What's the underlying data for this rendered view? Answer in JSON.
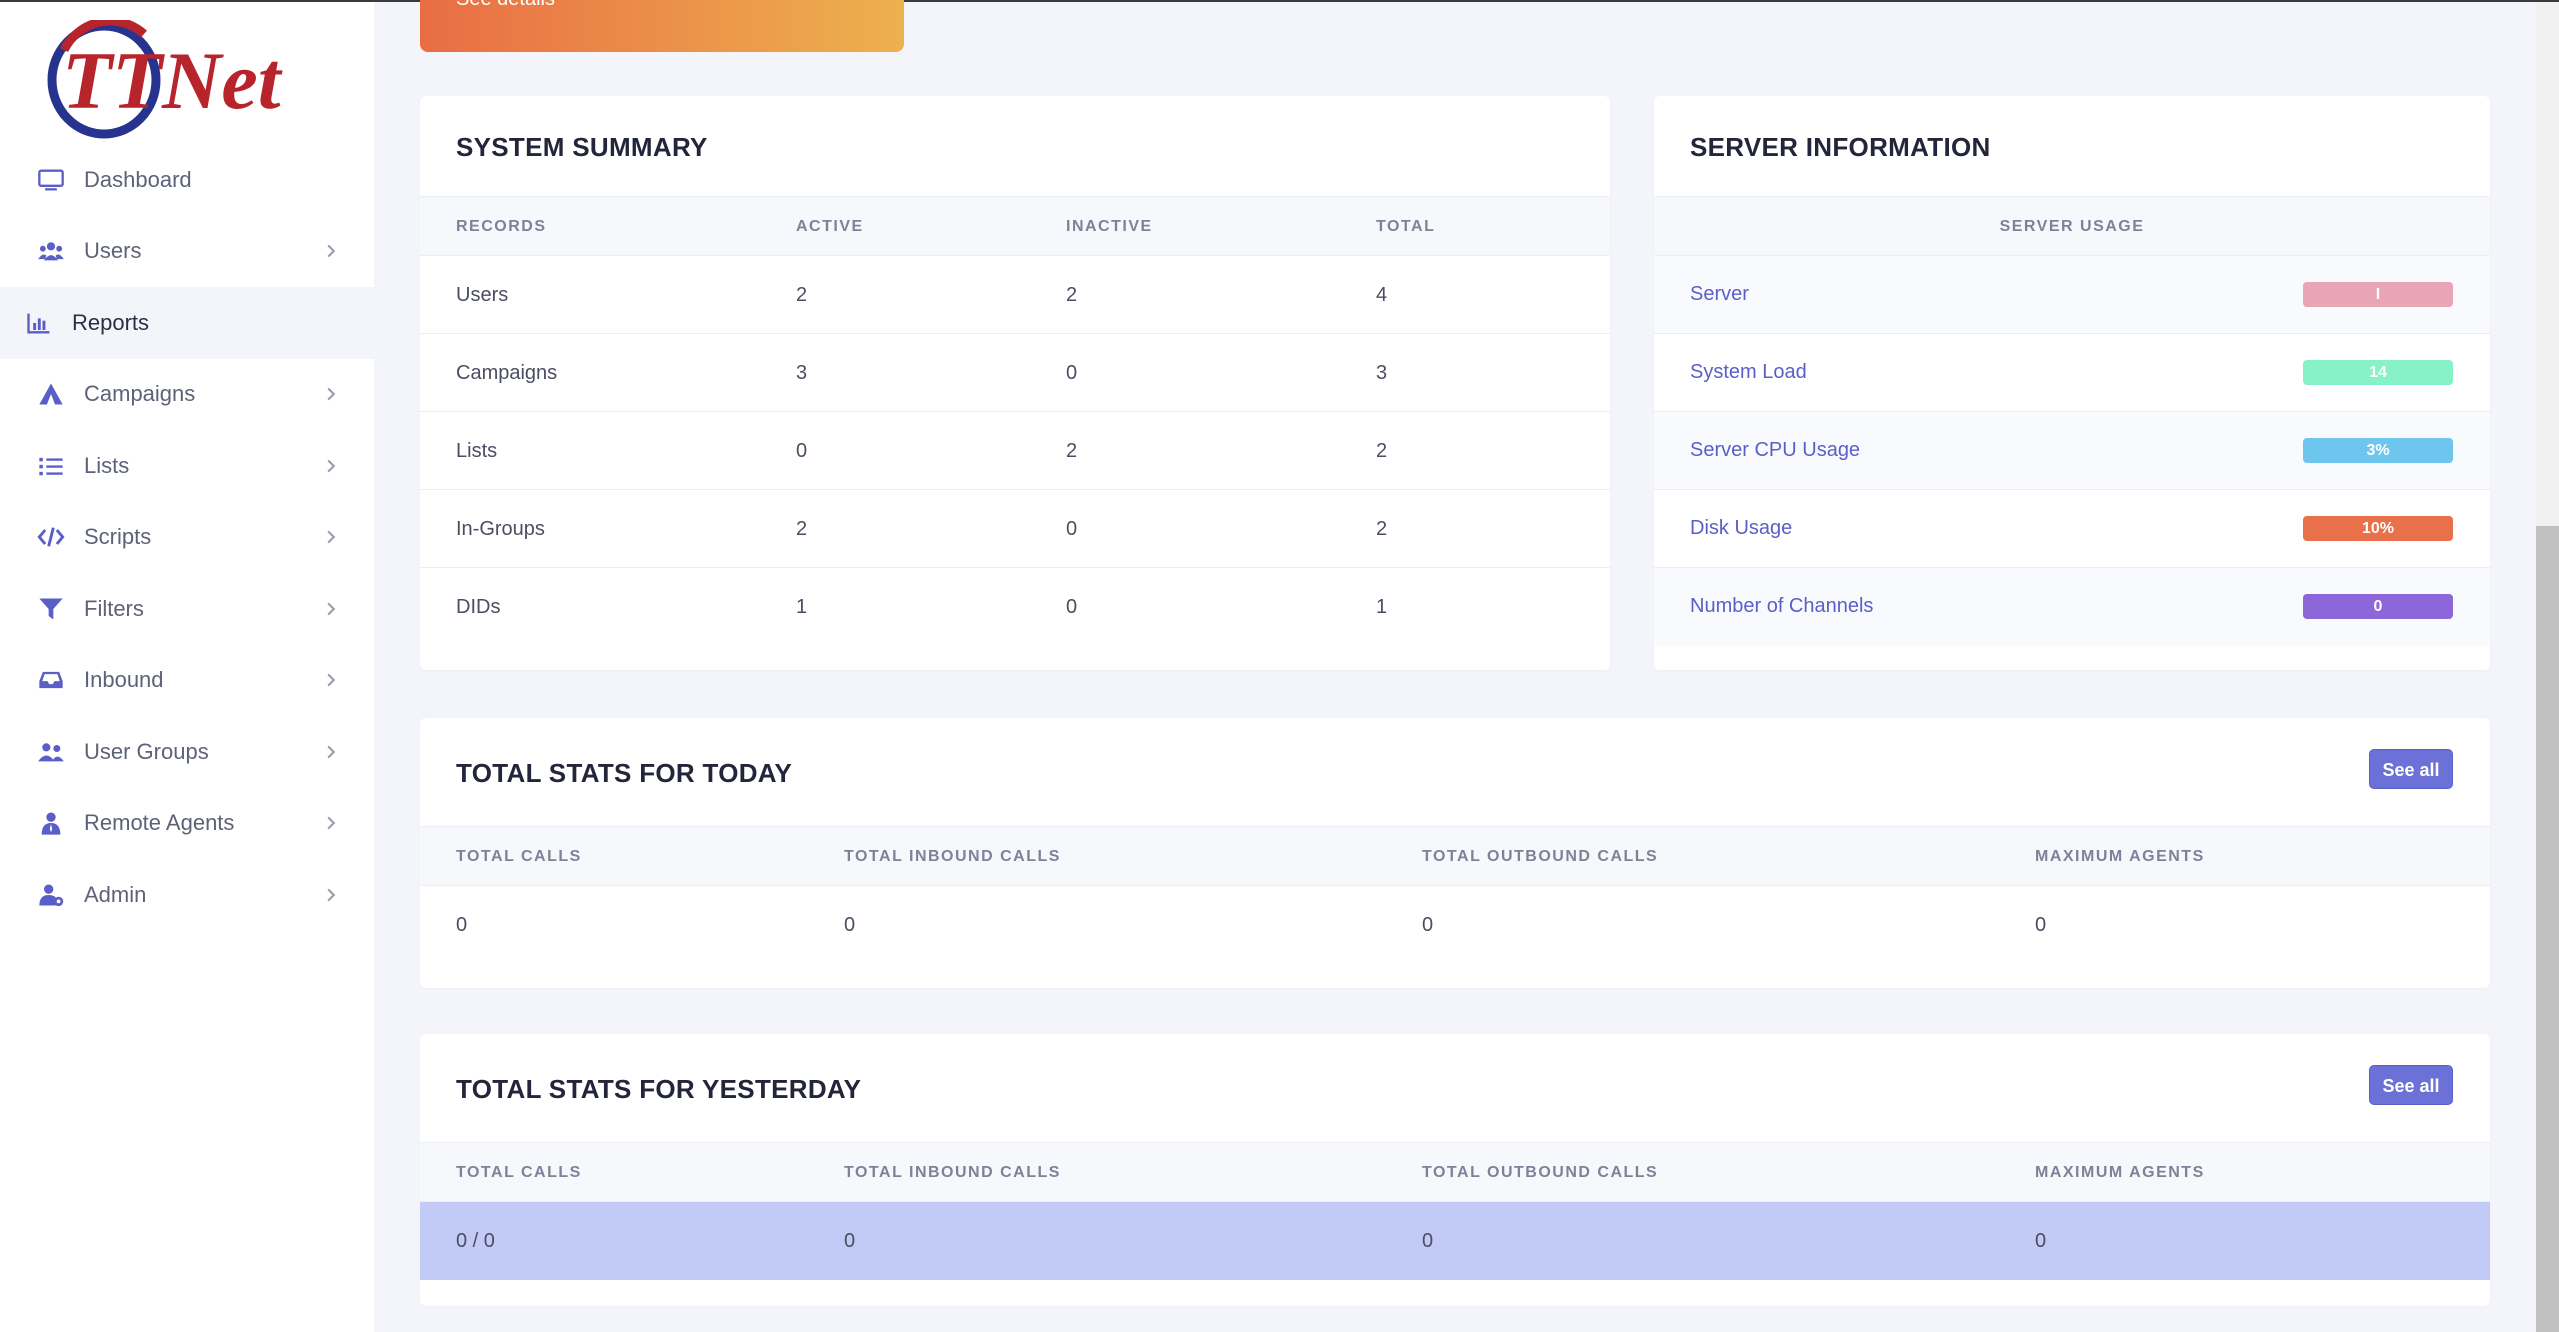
{
  "brand": {
    "logo_text": "TTNet"
  },
  "sidebar": {
    "items": [
      {
        "label": "Dashboard",
        "icon": "monitor-icon"
      },
      {
        "label": "Users",
        "icon": "users-icon"
      },
      {
        "label": "Reports",
        "icon": "bar-chart-icon"
      },
      {
        "label": "Campaigns",
        "icon": "campaign-icon"
      },
      {
        "label": "Lists",
        "icon": "list-icon"
      },
      {
        "label": "Scripts",
        "icon": "code-icon"
      },
      {
        "label": "Filters",
        "icon": "filter-icon"
      },
      {
        "label": "Inbound",
        "icon": "inbox-icon"
      },
      {
        "label": "User Groups",
        "icon": "user-group-icon"
      },
      {
        "label": "Remote Agents",
        "icon": "agent-icon"
      },
      {
        "label": "Admin",
        "icon": "admin-icon"
      }
    ]
  },
  "banner": {
    "link": "See details"
  },
  "system_summary": {
    "title": "SYSTEM SUMMARY",
    "headers": [
      "RECORDS",
      "ACTIVE",
      "INACTIVE",
      "TOTAL"
    ],
    "rows": [
      [
        "Users",
        "2",
        "2",
        "4"
      ],
      [
        "Campaigns",
        "3",
        "0",
        "3"
      ],
      [
        "Lists",
        "0",
        "2",
        "2"
      ],
      [
        "In-Groups",
        "2",
        "0",
        "2"
      ],
      [
        "DIDs",
        "1",
        "0",
        "1"
      ]
    ]
  },
  "server_info": {
    "title": "SERVER INFORMATION",
    "header": "SERVER USAGE",
    "rows": [
      {
        "label": "Server",
        "value": "I",
        "color": "#e8a5b4"
      },
      {
        "label": "System Load",
        "value": "14",
        "color": "#86f2c6"
      },
      {
        "label": "Server CPU Usage",
        "value": "3%",
        "color": "#6ec6ef"
      },
      {
        "label": "Disk Usage",
        "value": "10%",
        "color": "#e8704a"
      },
      {
        "label": "Number of Channels",
        "value": "0",
        "color": "#8d66d9"
      }
    ]
  },
  "today": {
    "title": "TOTAL STATS FOR TODAY",
    "see_all": "See all",
    "headers": [
      "TOTAL CALLS",
      "TOTAL INBOUND CALLS",
      "TOTAL OUTBOUND CALLS",
      "MAXIMUM AGENTS"
    ],
    "values": [
      "0",
      "0",
      "0",
      "0"
    ]
  },
  "yesterday": {
    "title": "TOTAL STATS FOR YESTERDAY",
    "see_all": "See all",
    "headers": [
      "TOTAL CALLS",
      "TOTAL INBOUND CALLS",
      "TOTAL OUTBOUND CALLS",
      "MAXIMUM AGENTS"
    ],
    "values": [
      "0 / 0",
      "0",
      "0",
      "0"
    ],
    "highlight_color": "#c1cbf5"
  },
  "colors": {
    "accent": "#6b71d6",
    "icon": "#5a5fc7",
    "logo_red": "#b8242c",
    "logo_blue": "#27348f"
  }
}
